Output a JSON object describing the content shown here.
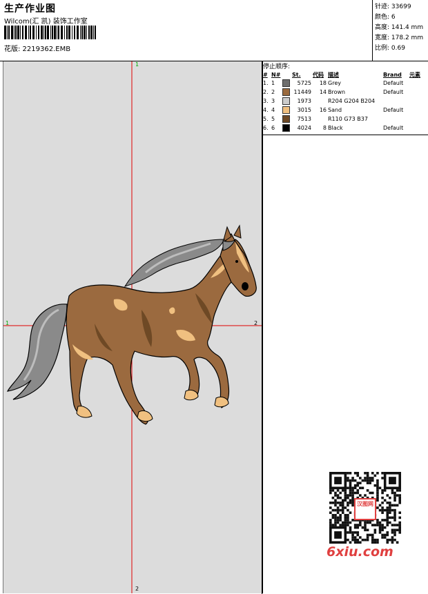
{
  "header": {
    "title": "生产作业图",
    "company": "Wilcom(汇 凯) 装饰工作室",
    "design_file": "花版: 2219362.EMB"
  },
  "stats": [
    {
      "label": "针迹",
      "value": "33699"
    },
    {
      "label": "颜色",
      "value": "6"
    },
    {
      "label": "高度",
      "value": "141.4 mm"
    },
    {
      "label": "宽度",
      "value": "178.2 mm"
    },
    {
      "label": "比例",
      "value": "0.69"
    }
  ],
  "stops": {
    "label": "停止顺序:",
    "columns": [
      "#",
      "N#",
      "St.",
      "代码",
      "描述",
      "Brand",
      "元素"
    ],
    "rows": [
      {
        "idx": "1.",
        "n": "1",
        "color": "#6e6e6e",
        "st": "5725",
        "code": "18",
        "desc": "Grey",
        "brand": "Default"
      },
      {
        "idx": "2.",
        "n": "2",
        "color": "#9a6a3e",
        "st": "11449",
        "code": "14",
        "desc": "Brown",
        "brand": "Default"
      },
      {
        "idx": "3.",
        "n": "3",
        "color": "#cccccc",
        "st": "1973",
        "code": "",
        "desc": "R204 G204 B204",
        "brand": ""
      },
      {
        "idx": "4.",
        "n": "4",
        "color": "#f0c080",
        "st": "3015",
        "code": "16",
        "desc": "Sand",
        "brand": "Default"
      },
      {
        "idx": "5.",
        "n": "5",
        "color": "#6e4925",
        "st": "7513",
        "code": "",
        "desc": "R110 G73 B37",
        "brand": ""
      },
      {
        "idx": "6.",
        "n": "6",
        "color": "#000000",
        "st": "4024",
        "code": "8",
        "desc": "Black",
        "brand": "Default"
      }
    ]
  },
  "axes": {
    "top": "1",
    "left": "1",
    "right": "2",
    "bottom": "2"
  },
  "watermark": "6xiu.com",
  "qr_stamp": "汉图网"
}
